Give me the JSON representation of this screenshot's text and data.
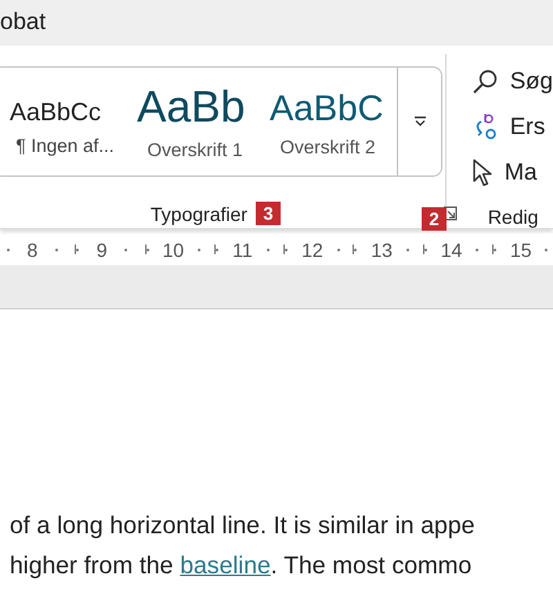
{
  "window": {
    "title": "obat"
  },
  "styles_group": {
    "label": "Typografier",
    "badge": "3",
    "styles": [
      {
        "kind": "normal",
        "preview": "AaBbCc",
        "name": "¶ Ingen af..."
      },
      {
        "kind": "heading1",
        "preview": "AaBb",
        "name": "Overskrift 1"
      },
      {
        "kind": "heading2",
        "preview": "AaBbC",
        "name": "Overskrift 2"
      }
    ],
    "launcher_badge": "2"
  },
  "editing_group": {
    "label": "Redig",
    "items": [
      {
        "kind": "search",
        "label": "Søg"
      },
      {
        "kind": "replace",
        "label": "Ers"
      },
      {
        "kind": "select",
        "label": "Ma"
      }
    ]
  },
  "ruler": {
    "numbers": [
      "8",
      "9",
      "10",
      "11",
      "12",
      "13",
      "14",
      "15"
    ]
  },
  "document": {
    "line_1": "of a long horizontal line. It is similar in appe",
    "line_2": {
      "before": "higher from the ",
      "link": "baseline",
      "after": ". The most commo"
    }
  }
}
